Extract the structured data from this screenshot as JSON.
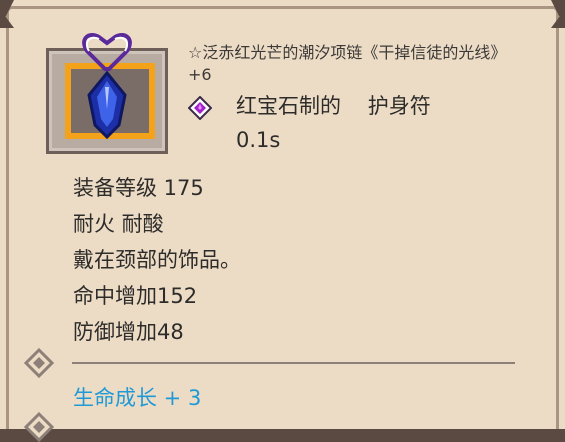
{
  "item": {
    "title": "☆泛赤红光芒的潮汐项链《干掉信徒的光线》+6",
    "type_line": "红宝石制的    护身符",
    "cast_time": "0.1s",
    "icon": "sapphire-pendant-icon",
    "slot_icon": "purple-gem-icon"
  },
  "stats": [
    "装备等级 175",
    "耐火 耐酸",
    "戴在颈部的饰品。",
    "命中增加152",
    "防御增加48"
  ],
  "bonus": {
    "text": "生命成长 + 3",
    "color": "#1f9ad6"
  },
  "colors": {
    "panel": "#ecdcc6",
    "frame_highlight": "#f4a21a",
    "text": "#2e2c2a"
  }
}
